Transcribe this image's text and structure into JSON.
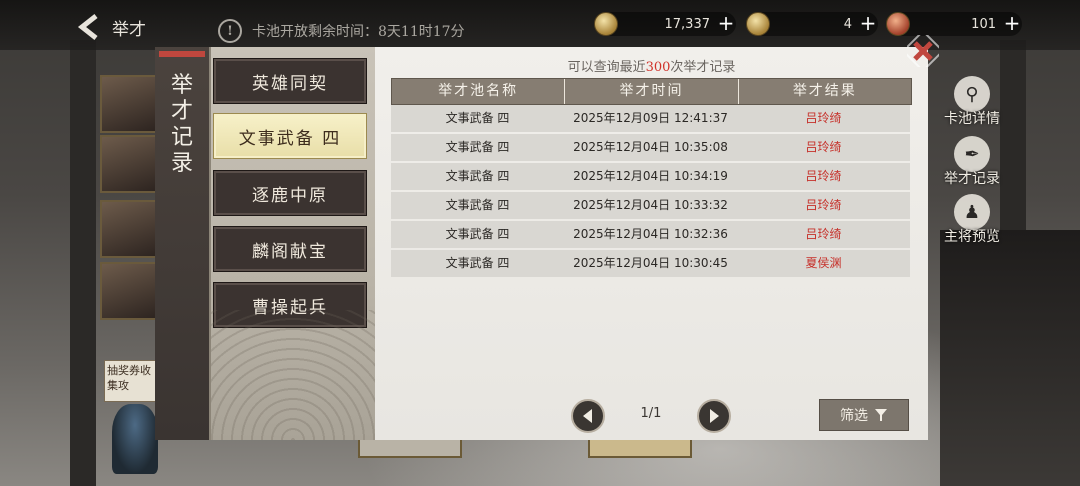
{
  "header": {
    "back_label": "举才",
    "notice": "卡池开放剩余时间：8天11时17分",
    "currencies": [
      {
        "icon": "copper-coin-icon",
        "value": "17,337"
      },
      {
        "icon": "token-icon",
        "value": "4"
      },
      {
        "icon": "flower-token-icon",
        "value": "101"
      }
    ]
  },
  "background": {
    "side_label": "抽奖券收集攻",
    "right_menu": [
      {
        "icon": "magnifier-icon",
        "label": "卡池详情"
      },
      {
        "icon": "brush-icon",
        "label": "举才记录"
      },
      {
        "icon": "general-icon",
        "label": "主将预览"
      }
    ]
  },
  "modal": {
    "title": "举才记录",
    "tabs": [
      {
        "label": "英雄同契",
        "active": false
      },
      {
        "label": "文事武备 四",
        "active": true
      },
      {
        "label": "逐鹿中原",
        "active": false
      },
      {
        "label": "麟阁献宝",
        "active": false
      },
      {
        "label": "曹操起兵",
        "active": false
      }
    ],
    "hint_prefix": "可以查询最近",
    "hint_count": "300",
    "hint_suffix": "次举才记录",
    "columns": [
      "举才池名称",
      "举才时间",
      "举才结果"
    ],
    "records": [
      {
        "pool": "文事武备 四",
        "time": "2025年12月09日 12:41:37",
        "result": "吕玲绮"
      },
      {
        "pool": "文事武备 四",
        "time": "2025年12月04日 10:35:08",
        "result": "吕玲绮"
      },
      {
        "pool": "文事武备 四",
        "time": "2025年12月04日 10:34:19",
        "result": "吕玲绮"
      },
      {
        "pool": "文事武备 四",
        "time": "2025年12月04日 10:33:32",
        "result": "吕玲绮"
      },
      {
        "pool": "文事武备 四",
        "time": "2025年12月04日 10:32:36",
        "result": "吕玲绮"
      },
      {
        "pool": "文事武备 四",
        "time": "2025年12月04日 10:30:45",
        "result": "夏侯渊"
      }
    ],
    "pagination": "1/1",
    "filter_label": "筛选",
    "accent_color": "#d0322a"
  }
}
